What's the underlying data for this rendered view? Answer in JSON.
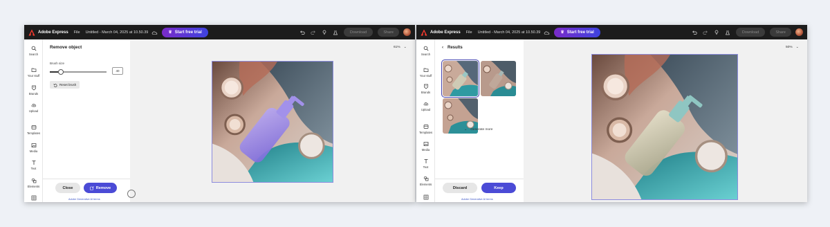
{
  "topbar": {
    "app_name": "Adobe Express",
    "file_menu": "File",
    "doc_title": "Untitled - March 04, 2025 at 10.50.39",
    "trial_button": "Start free trial",
    "download_button": "Download",
    "share_button": "Share"
  },
  "rail": {
    "left": [
      {
        "label": "Search",
        "icon": "search-icon"
      },
      {
        "label": "Your stuff",
        "icon": "folder-icon"
      },
      {
        "label": "Brands",
        "icon": "brand-icon"
      },
      {
        "label": "Upload",
        "icon": "upload-icon"
      },
      {
        "label": "Templates",
        "icon": "templates-icon"
      },
      {
        "label": "Media",
        "icon": "media-icon"
      },
      {
        "label": "Text",
        "icon": "text-icon"
      },
      {
        "label": "Elements",
        "icon": "elements-icon"
      }
    ]
  },
  "left_panel": {
    "title": "Remove object",
    "brush_size_label": "Brush size",
    "brush_size_value": "40",
    "brush_size_fraction": 0.2,
    "reset_button": "Reset brush",
    "close_button": "Close",
    "remove_button": "Remove",
    "genai_note": "Adobe Generative AI terms"
  },
  "right_panel": {
    "title": "Results",
    "generate_more": "Generate more",
    "discard_button": "Discard",
    "keep_button": "Keep",
    "genai_note": "Adobe Generative AI terms"
  },
  "zoom": {
    "left": "61%",
    "right": "50%"
  },
  "colors": {
    "accent": "#4b4bd6",
    "trial_gradient_start": "#7a2bc8",
    "trial_gradient_end": "#3e43e0",
    "topbar": "#1c1c1c"
  }
}
